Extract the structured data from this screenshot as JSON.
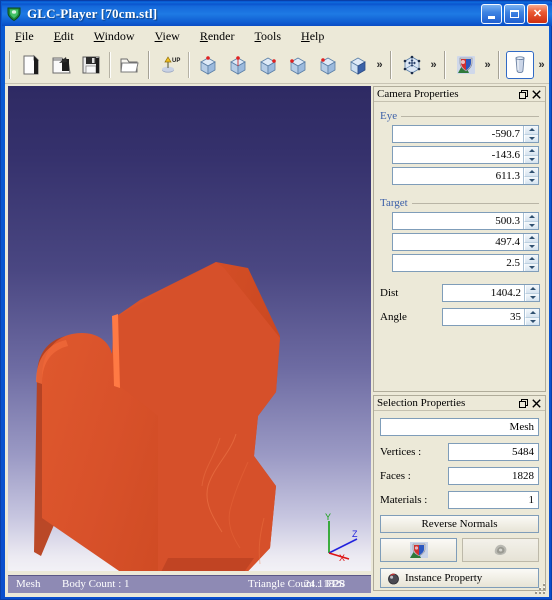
{
  "window": {
    "title": "GLC-Player [70cm.stl]",
    "icon": "app-shield-icon",
    "buttons": {
      "minimize": "minimize-button",
      "maximize": "maximize-button",
      "close": "close-button"
    }
  },
  "menubar": {
    "items": [
      {
        "label": "File",
        "accel": "F"
      },
      {
        "label": "Edit",
        "accel": "E"
      },
      {
        "label": "Window",
        "accel": "W"
      },
      {
        "label": "View",
        "accel": "V"
      },
      {
        "label": "Render",
        "accel": "R"
      },
      {
        "label": "Tools",
        "accel": "T"
      },
      {
        "label": "Help",
        "accel": "H"
      }
    ]
  },
  "toolbar": {
    "groups": [
      {
        "name": "file",
        "buttons": [
          {
            "icon": "new-file-icon",
            "active": false
          },
          {
            "icon": "open-file-icon",
            "active": false
          },
          {
            "icon": "save-file-icon",
            "active": false
          }
        ],
        "after_sep": [
          {
            "icon": "open-folder-icon",
            "active": false
          }
        ],
        "overflow": false
      },
      {
        "name": "view-orientation",
        "buttons": [
          {
            "icon": "up-vector-icon",
            "active": false
          },
          {
            "icon": "view-front-icon",
            "active": false
          },
          {
            "icon": "view-back-icon",
            "active": false
          },
          {
            "icon": "view-left-icon",
            "active": false
          },
          {
            "icon": "view-right-icon",
            "active": false
          },
          {
            "icon": "view-top-icon",
            "active": false
          },
          {
            "icon": "view-iso-icon",
            "active": false
          }
        ],
        "overflow": true
      },
      {
        "name": "fit-space",
        "buttons": [
          {
            "icon": "fit-to-view-icon",
            "active": false
          }
        ],
        "overflow": true
      },
      {
        "name": "shading",
        "buttons": [
          {
            "icon": "material-shading-icon",
            "active": false
          }
        ],
        "overflow": true
      },
      {
        "name": "selection-mode",
        "buttons": [
          {
            "icon": "instance-select-icon",
            "active": true
          }
        ],
        "overflow": true
      },
      {
        "name": "capture",
        "buttons": [
          {
            "icon": "screenshot-camera-icon",
            "active": false
          }
        ],
        "overflow": true
      }
    ],
    "overflow_glyph": "»"
  },
  "viewport": {
    "name": "3d-viewport",
    "background_top": "#2e2a63",
    "background_bottom": "#f2f1f6",
    "model_color": "#d8512a",
    "model_shadow_color": "#a83a1c",
    "axis_gizmo": {
      "x_label": "X",
      "x_color": "#e01010",
      "y_label": "Y",
      "y_color": "#10a010",
      "z_label": "Z",
      "z_color": "#2020e0"
    }
  },
  "statusbar": {
    "selection_type": "Mesh",
    "body_count": "Body Count : 1",
    "triangle_count": "Triangle Count : 1828",
    "fps": "24.1 FPS"
  },
  "camera_panel": {
    "title": "Camera Properties",
    "float_icon": "float-panel-icon",
    "close_icon": "close-panel-icon",
    "eye": {
      "label": "Eye",
      "x": "-590.7",
      "y": "-143.6",
      "z": "611.3"
    },
    "target": {
      "label": "Target",
      "x": "500.3",
      "y": "497.4",
      "z": "2.5"
    },
    "dist": {
      "label": "Dist",
      "value": "1404.2"
    },
    "angle": {
      "label": "Angle",
      "value": "35"
    }
  },
  "selection_panel": {
    "title": "Selection Properties",
    "float_icon": "float-panel-icon",
    "close_icon": "close-panel-icon",
    "name_value": "Mesh",
    "vertices": {
      "label": "Vertices :",
      "value": "5484"
    },
    "faces": {
      "label": "Faces :",
      "value": "1828"
    },
    "materials": {
      "label": "Materials :",
      "value": "1"
    },
    "reverse_normals_label": "Reverse Normals",
    "material_button_icon": "material-sphere-icon",
    "texture_button_icon": "texture-swatch-icon",
    "instance_property_label": "Instance Property",
    "instance_property_icon": "instance-bullet-icon"
  }
}
